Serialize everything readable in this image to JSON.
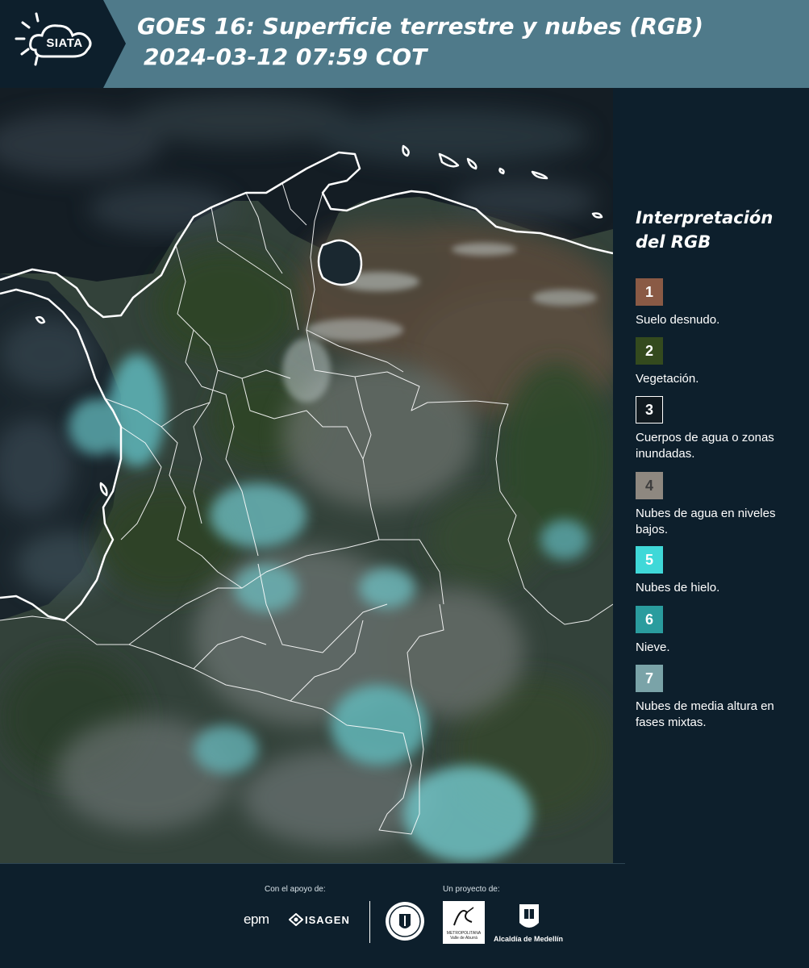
{
  "header": {
    "logo_text": "SIATA",
    "title_line1": "GOES 16: Superficie terrestre y nubes (RGB)",
    "title_line2": "2024-03-12 07:59 COT"
  },
  "legend": {
    "title_line1": "Interpretación",
    "title_line2": "del RGB",
    "items": [
      {
        "number": "1",
        "label": "Suelo desnudo.",
        "color": "#8a5a45"
      },
      {
        "number": "2",
        "label": "Vegetación.",
        "color": "#344a1e"
      },
      {
        "number": "3",
        "label": "Cuerpos de agua o zonas inundadas.",
        "color": "#111a20"
      },
      {
        "number": "4",
        "label": "Nubes de agua en niveles bajos.",
        "color": "#8e8880"
      },
      {
        "number": "5",
        "label": "Nubes de hielo.",
        "color": "#3fd8d8"
      },
      {
        "number": "6",
        "label": "Nieve.",
        "color": "#2a9c9e"
      },
      {
        "number": "7",
        "label": "Nubes de media altura en fases mixtas.",
        "color": "#7aa3a8"
      }
    ]
  },
  "footer": {
    "support_label": "Con el apoyo de:",
    "project_label": "Un proyecto de:",
    "sponsor1": "epm",
    "sponsor2": "ISAGEN",
    "partner_metro_text": "METROPOLITANA Valle de Aburrá",
    "partner_metro_logo": "Área",
    "partner_alcaldia": "Alcaldía de Medellín"
  },
  "map": {
    "description_icon": "satellite-rgb-map-colombia",
    "border_color": "#ffffff"
  }
}
